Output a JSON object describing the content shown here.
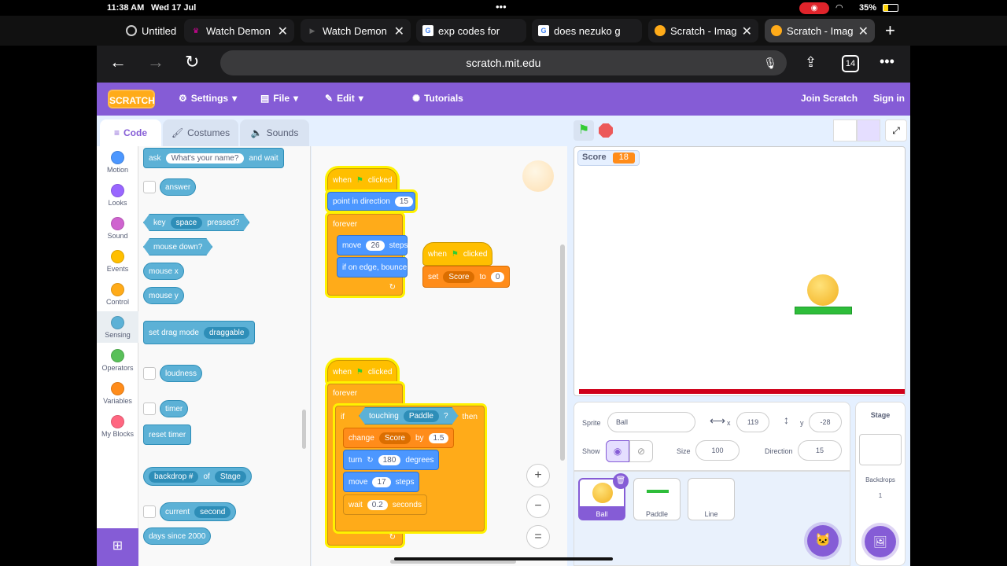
{
  "status": {
    "time": "11:38 AM",
    "date": "Wed 17 Jul",
    "battery": "35%"
  },
  "tabs": [
    {
      "label": "Untitled"
    },
    {
      "label": "Watch Demon"
    },
    {
      "label": "Watch Demon"
    },
    {
      "label": "exp codes for"
    },
    {
      "label": "does nezuko g"
    },
    {
      "label": "Scratch - Imag"
    },
    {
      "label": "Scratch - Imag"
    }
  ],
  "browser": {
    "url": "scratch.mit.edu",
    "tab_count": "14"
  },
  "menu": {
    "logo": "SCRATCH",
    "settings": "Settings",
    "file": "File",
    "edit": "Edit",
    "tutorials": "Tutorials",
    "join": "Join Scratch",
    "signin": "Sign in"
  },
  "editor_tabs": {
    "code": "Code",
    "costumes": "Costumes",
    "sounds": "Sounds"
  },
  "categories": [
    "Motion",
    "Looks",
    "Sound",
    "Events",
    "Control",
    "Sensing",
    "Operators",
    "Variables",
    "My Blocks"
  ],
  "category_colors": [
    "#4c97ff",
    "#9966ff",
    "#cf63cf",
    "#ffbf00",
    "#ffab19",
    "#5cb1d6",
    "#59c059",
    "#ff8c1a",
    "#ff6680"
  ],
  "palette": {
    "ask": "ask",
    "ask_input": "What's your name?",
    "and_wait": "and wait",
    "answer": "answer",
    "key": "key",
    "key_space": "space",
    "pressed": "pressed?",
    "mouse_down": "mouse down?",
    "mouse_x": "mouse x",
    "mouse_y": "mouse y",
    "drag": "set drag mode",
    "draggable": "draggable",
    "loudness": "loudness",
    "timer": "timer",
    "reset_timer": "reset timer",
    "backdrop": "backdrop #",
    "of": "of",
    "stage": "Stage",
    "current": "current",
    "second": "second",
    "days": "days since 2000"
  },
  "script1": {
    "when": "when",
    "clicked": "clicked",
    "point": "point in direction",
    "dir": "15",
    "forever": "forever",
    "move": "move",
    "steps": "steps",
    "move_val": "26",
    "bounce": "if on edge, bounce"
  },
  "script2": {
    "when": "when",
    "clicked": "clicked",
    "set": "set",
    "var": "Score",
    "to": "to",
    "val": "0"
  },
  "script3": {
    "when": "when",
    "clicked": "clicked",
    "forever": "forever",
    "if": "if",
    "touching": "touching",
    "paddle": "Paddle",
    "q": "?",
    "then": "then",
    "change": "change",
    "score": "Score",
    "by": "by",
    "by_val": "1.5",
    "turn": "turn",
    "turn_val": "180",
    "degrees": "degrees",
    "move": "move",
    "move_val": "17",
    "steps": "steps",
    "wait": "wait",
    "wait_val": "0.2",
    "seconds": "seconds"
  },
  "zoom": {
    "in": "+",
    "out": "−",
    "reset": "="
  },
  "stage": {
    "monitor_label": "Score",
    "monitor_value": "18"
  },
  "sprite_info": {
    "sprite_label": "Sprite",
    "sprite_name": "Ball",
    "x_label": "x",
    "x": "119",
    "y_label": "y",
    "y": "-28",
    "show_label": "Show",
    "size_label": "Size",
    "size": "100",
    "dir_label": "Direction",
    "dir": "15"
  },
  "sprites": [
    {
      "name": "Ball"
    },
    {
      "name": "Paddle"
    },
    {
      "name": "Line"
    }
  ],
  "stage_panel": {
    "title": "Stage",
    "backdrops_label": "Backdrops",
    "backdrops_count": "1"
  }
}
